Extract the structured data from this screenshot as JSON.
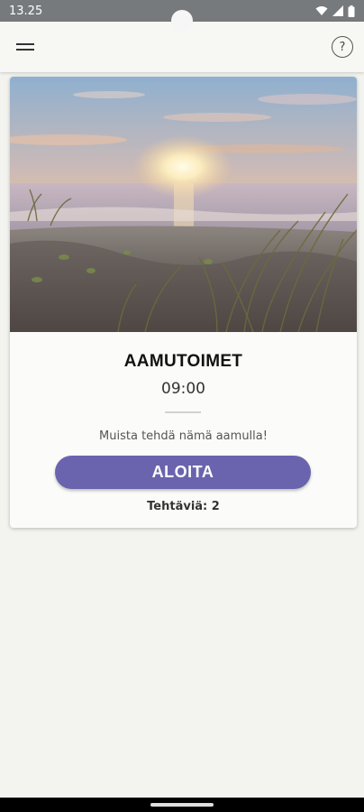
{
  "status_bar": {
    "time": "13.25",
    "icons": [
      "wifi-icon",
      "signal-icon",
      "battery-icon"
    ]
  },
  "app_bar": {
    "menu_icon": "hamburger-menu-icon",
    "help_label": "?"
  },
  "routine_card": {
    "image": "beach-sunrise-image",
    "title": "AAMUTOIMET",
    "time": "09:00",
    "description": "Muista tehdä nämä aamulla!",
    "start_label": "ALOITA",
    "task_count": "Tehtäviä: 2"
  },
  "colors": {
    "accent": "#6a64ae",
    "status_bar": "#777a7c",
    "background": "#f3f3ef"
  }
}
